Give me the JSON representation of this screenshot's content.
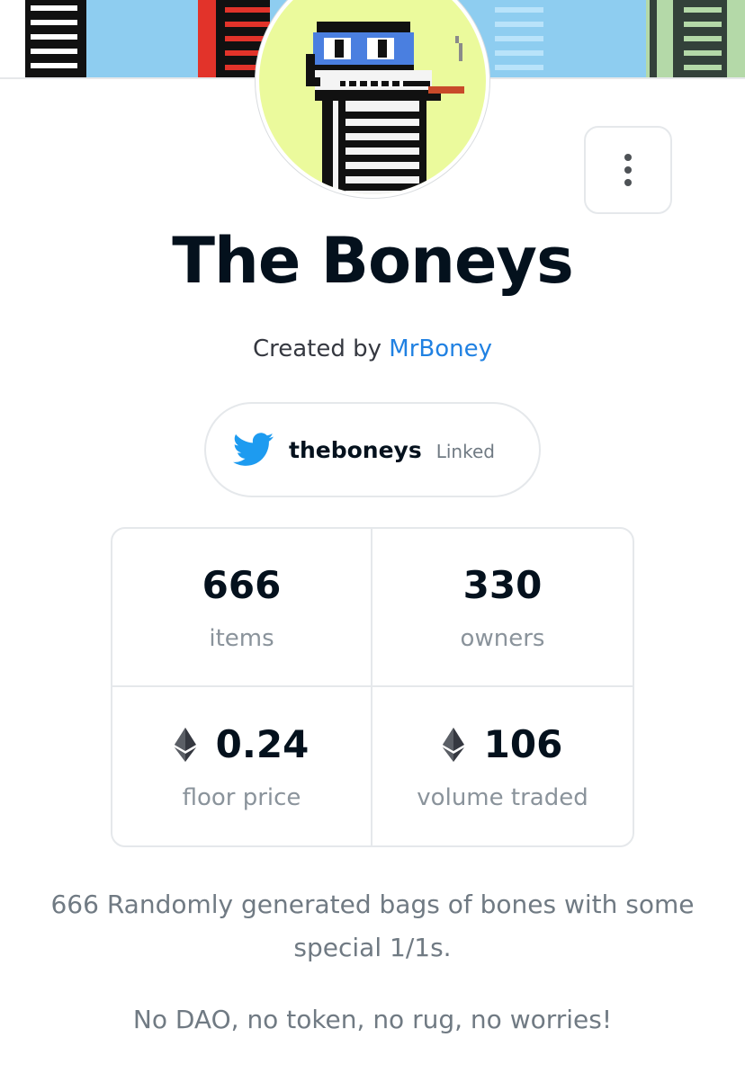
{
  "collection": {
    "name": "The Boneys",
    "created_by_prefix": "Created by",
    "creator": "MrBoney",
    "twitter": {
      "icon": "twitter-bird-icon",
      "handle": "theboneys",
      "status": "Linked"
    }
  },
  "stats": [
    {
      "value": "666",
      "label": "items",
      "currency_icon": null
    },
    {
      "value": "330",
      "label": "owners",
      "currency_icon": null
    },
    {
      "value": "0.24",
      "label": "floor price",
      "currency_icon": "ethereum-icon"
    },
    {
      "value": "106",
      "label": "volume traded",
      "currency_icon": "ethereum-icon"
    }
  ],
  "description": "666 Randomly generated bags of bones with some special 1/1s.",
  "tagline": "No DAO, no token, no rug, no worries!",
  "colors": {
    "title": "#04111d",
    "link": "#2081e2",
    "muted": "#707a83",
    "border": "#e5e8eb",
    "twitter": "#1d9bf0",
    "avatar_bg": "#ebfa9c"
  }
}
